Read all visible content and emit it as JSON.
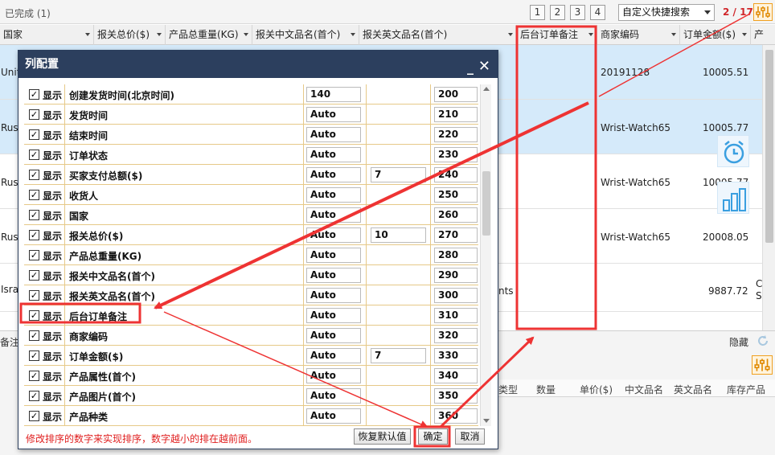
{
  "toolbar": {
    "status_text": "已完成 (1)",
    "pages": [
      "1",
      "2",
      "3",
      "4"
    ],
    "search_select_value": "自定义快捷搜索",
    "page_count": "2 / 17"
  },
  "grid": {
    "columns": [
      "国家",
      "报关总价($)",
      "产品总重量(KG)",
      "报关中文品名(首个)",
      "报关英文品名(首个)",
      "后台订单备注",
      "商家编码",
      "订单金额($)",
      "产"
    ],
    "rows": [
      {
        "country": "Unit",
        "code": "20191128",
        "amount": "10005.51"
      },
      {
        "country": "Rus",
        "code": "Wrist-Watch65",
        "amount": "10005.77"
      },
      {
        "country": "Rus",
        "code": "Wrist-Watch65",
        "amount": "10005.77"
      },
      {
        "country": "Rus",
        "code": "Wrist-Watch65",
        "amount": "20008.05"
      },
      {
        "country": "Isra",
        "extra": "nts",
        "code": "",
        "amount": "9887.72",
        "trail": "C\nS"
      }
    ]
  },
  "bottom_panel": {
    "left_tab": "备注",
    "hide_label": "隐藏",
    "subheaders": [
      "类型",
      "数量",
      "单价($)",
      "中文品名",
      "英文品名",
      "库存产品"
    ]
  },
  "dialog": {
    "title": "列配置",
    "show_label": "显示",
    "rows": [
      {
        "name": "创建发货时间(北京时间)",
        "width": "140",
        "extra": "",
        "order": "200"
      },
      {
        "name": "发货时间",
        "width": "Auto",
        "extra": "",
        "order": "210"
      },
      {
        "name": "结束时间",
        "width": "Auto",
        "extra": "",
        "order": "220"
      },
      {
        "name": "订单状态",
        "width": "Auto",
        "extra": "",
        "order": "230"
      },
      {
        "name": "买家支付总额($)",
        "width": "Auto",
        "extra": "7",
        "order": "240"
      },
      {
        "name": "收货人",
        "width": "Auto",
        "extra": "",
        "order": "250"
      },
      {
        "name": "国家",
        "width": "Auto",
        "extra": "",
        "order": "260"
      },
      {
        "name": "报关总价($)",
        "width": "Auto",
        "extra": "10",
        "order": "270"
      },
      {
        "name": "产品总重量(KG)",
        "width": "Auto",
        "extra": "",
        "order": "280"
      },
      {
        "name": "报关中文品名(首个)",
        "width": "Auto",
        "extra": "",
        "order": "290"
      },
      {
        "name": "报关英文品名(首个)",
        "width": "Auto",
        "extra": "",
        "order": "300"
      },
      {
        "name": "后台订单备注",
        "width": "Auto",
        "extra": "",
        "order": "310"
      },
      {
        "name": "商家编码",
        "width": "Auto",
        "extra": "",
        "order": "320"
      },
      {
        "name": "订单金额($)",
        "width": "Auto",
        "extra": "7",
        "order": "330"
      },
      {
        "name": "产品属性(首个)",
        "width": "Auto",
        "extra": "",
        "order": "340"
      },
      {
        "name": "产品图片(首个)",
        "width": "Auto",
        "extra": "",
        "order": "350"
      },
      {
        "name": "产品种类",
        "width": "Auto",
        "extra": "",
        "order": "360"
      }
    ],
    "tip": "修改排序的数字来实现排序，数字越小的排在越前面。",
    "restore_label": "恢复默认值",
    "ok_label": "确定",
    "cancel_label": "取消"
  },
  "colors": {
    "accent_red": "#ee3333",
    "title_bar": "#2c3f5e",
    "selected_row": "#d5eafa",
    "grid_line": "#e6c988"
  }
}
